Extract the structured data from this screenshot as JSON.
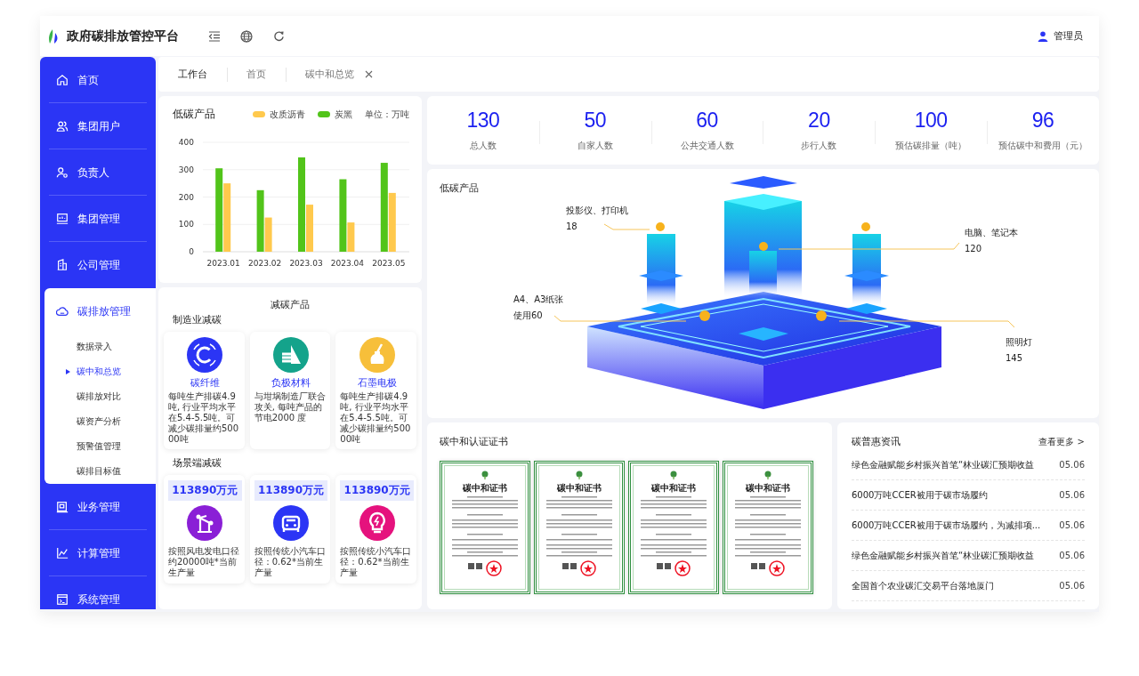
{
  "header": {
    "title": "政府碳排放管控平台",
    "user": "管理员"
  },
  "sidebar": {
    "items": [
      {
        "label": "首页",
        "expanded": false
      },
      {
        "label": "集团用户",
        "expanded": false
      },
      {
        "label": "负责人",
        "expanded": false
      },
      {
        "label": "集团管理",
        "expanded": false
      },
      {
        "label": "公司管理",
        "expanded": false
      },
      {
        "label": "碳排放管理",
        "expanded": true,
        "children": [
          {
            "label": "数据录入",
            "selected": false
          },
          {
            "label": "碳中和总览",
            "selected": true
          },
          {
            "label": "碳排放对比",
            "selected": false
          },
          {
            "label": "碳资产分析",
            "selected": false
          },
          {
            "label": "预警值管理",
            "selected": false
          },
          {
            "label": "碳排目标值",
            "selected": false
          }
        ]
      },
      {
        "label": "业务管理",
        "expanded": false
      },
      {
        "label": "计算管理",
        "expanded": false
      },
      {
        "label": "系统管理",
        "expanded": false
      }
    ]
  },
  "tabs": [
    {
      "label": "工作台",
      "selected": true,
      "closable": false
    },
    {
      "label": "首页",
      "selected": false,
      "closable": false
    },
    {
      "label": "碳中和总览",
      "selected": false,
      "closable": true
    }
  ],
  "low_carbon_chart": {
    "title": "低碳产品",
    "unit": "单位：万吨",
    "chart_data": {
      "type": "bar",
      "categories": [
        "2023.01",
        "2023.02",
        "2023.03",
        "2023.04",
        "2023.05"
      ],
      "series": [
        {
          "name": "改质沥青",
          "color": "#ffc94d",
          "values": [
            250,
            125,
            172,
            107,
            215
          ]
        },
        {
          "name": "炭黑",
          "color": "#52c41a",
          "values": [
            305,
            225,
            345,
            265,
            325
          ]
        }
      ],
      "ylim": [
        0,
        400
      ],
      "yticks": [
        0,
        100,
        200,
        300,
        400
      ],
      "grid": true
    }
  },
  "reduction": {
    "title": "减碳产品",
    "manufacturing": {
      "title": "制造业减碳",
      "items": [
        {
          "name": "碳纤维",
          "color": "#2b35f5",
          "description": "每吨生产排碳4.9吨, 行业平均水平在5.4-5.5吨。可减少碳排量约50000吨"
        },
        {
          "name": "负极材料",
          "color": "#14a38b",
          "description": "与坩埚制造厂联合攻关, 每吨产品的节电2000 度"
        },
        {
          "name": "石墨电极",
          "color": "#f7bf3a",
          "description": "每吨生产排碳4.9吨, 行业平均水平在5.4-5.5吨。可减少碳排量约50000吨"
        }
      ]
    },
    "scene": {
      "title": "场景端减碳",
      "items": [
        {
          "amount": "113890万元",
          "color": "#8a1fd6",
          "description": "按照风电发电口径约20000吨*当前生产量"
        },
        {
          "amount": "113890万元",
          "color": "#2b35f5",
          "description": "按照传统小汽车口径：0.62*当前生产量"
        },
        {
          "amount": "113890万元",
          "color": "#e5127d",
          "description": "按照传统小汽车口径：0.62*当前生产量"
        }
      ]
    }
  },
  "stats": [
    {
      "value": "130",
      "label": "总人数"
    },
    {
      "value": "50",
      "label": "自家人数"
    },
    {
      "value": "60",
      "label": "公共交通人数"
    },
    {
      "value": "20",
      "label": "步行人数"
    },
    {
      "value": "100",
      "label": "预估碳排量（吨）"
    },
    {
      "value": "96",
      "label": "预估碳中和费用（元）"
    }
  ],
  "illustration": {
    "title": "低碳产品",
    "callouts": [
      {
        "label": "投影仪、打印机",
        "value": "18"
      },
      {
        "label": "电脑、笔记本",
        "value": "120"
      },
      {
        "label": "A4、A3纸张",
        "value": "使用60"
      },
      {
        "label": "照明灯",
        "value": "145"
      }
    ]
  },
  "certificates": {
    "title": "碳中和认证证书",
    "items": [
      {
        "title": "碳中和证书"
      },
      {
        "title": "碳中和证书"
      },
      {
        "title": "碳中和证书"
      },
      {
        "title": "碳中和证书"
      }
    ]
  },
  "news": {
    "title": "碳普惠资讯",
    "more": "查看更多 >",
    "items": [
      {
        "title": "绿色金融赋能乡村振兴首笔“林业碳汇预期收益",
        "date": "05.06"
      },
      {
        "title": "6000万吨CCER被用于碳市场履约",
        "date": "05.06"
      },
      {
        "title": "6000万吨CCER被用于碳市场履约，为减排项...",
        "date": "05.06"
      },
      {
        "title": "绿色金融赋能乡村振兴首笔“林业碳汇预期收益",
        "date": "05.06"
      },
      {
        "title": "全国首个农业碳汇交易平台落地厦门",
        "date": "05.06"
      }
    ]
  }
}
